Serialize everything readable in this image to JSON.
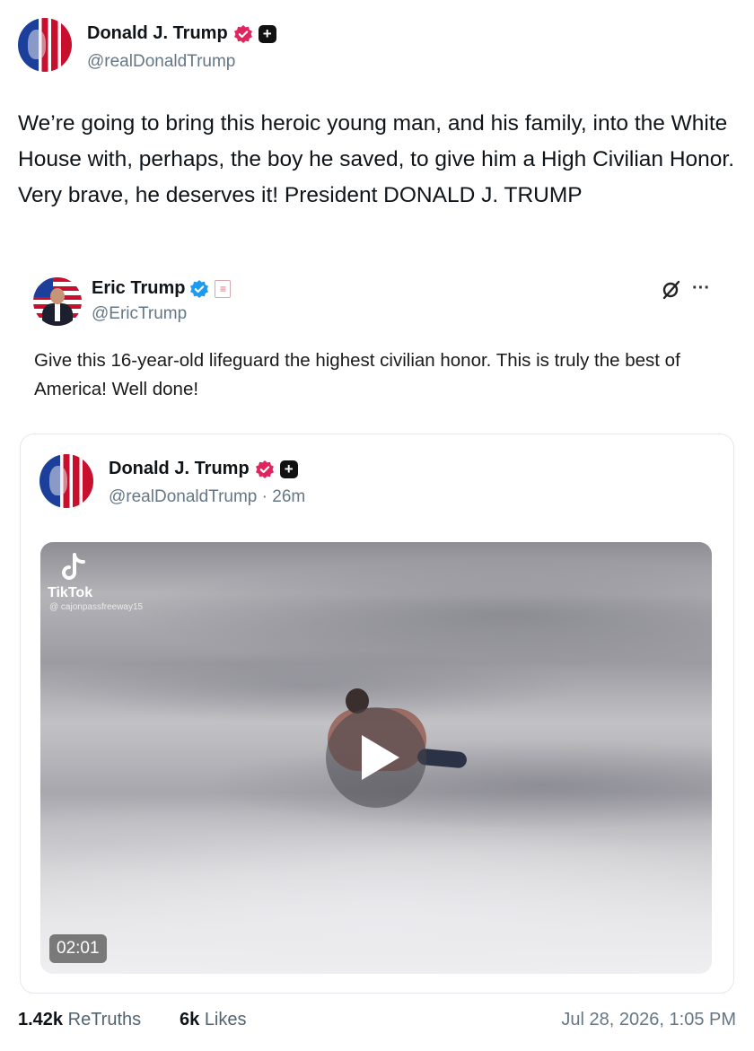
{
  "post": {
    "author": {
      "name": "Donald J. Trump",
      "handle": "@realDonaldTrump",
      "avatar_icon": "flag-portrait-avatar",
      "verified_badge_color": "#e0245e"
    },
    "text": "We’re going to bring this heroic young man, and his family, into the White House with, perhaps, the boy he saved, to give him a High Civilian Honor. Very brave, he deserves it! President DONALD J. TRUMP"
  },
  "embedded_post": {
    "author": {
      "name": "Eric Trump",
      "handle": "@EricTrump",
      "verified_badge_color": "#1d9bf0"
    },
    "text": "Give this 16-year-old lifeguard the highest civilian honor.  This is truly the best of America! Well done!",
    "quoted_post": {
      "author": {
        "name": "Donald J. Trump",
        "handle": "@realDonaldTrump",
        "time_ago": "26m"
      },
      "video": {
        "watermark_brand": "TikTok",
        "watermark_user": "@ cajonpassfreeway15",
        "duration": "02:01"
      }
    }
  },
  "footer": {
    "retruths_count": "1.42k",
    "retruths_label": "ReTruths",
    "likes_count": "6k",
    "likes_label": "Likes",
    "timestamp": "Jul 28, 2026, 1:05 PM"
  }
}
